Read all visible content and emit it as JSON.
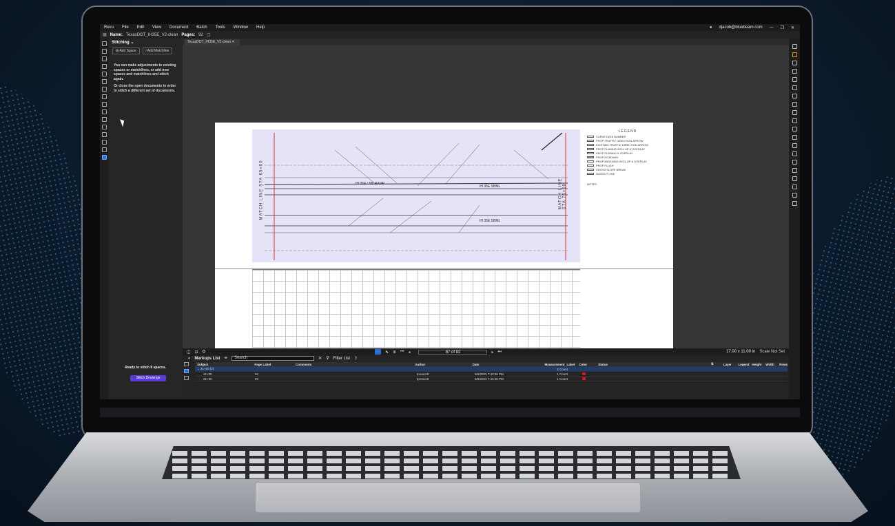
{
  "menu": [
    "Revu",
    "File",
    "Edit",
    "View",
    "Document",
    "Batch",
    "Tools",
    "Window",
    "Help"
  ],
  "account": "djacob@bluebeam.com",
  "tabbar": {
    "name_label": "Name:",
    "name_value": "TexasDOT_IH35E_V2-clean",
    "pages_label": "Pages:",
    "pages_value": "92"
  },
  "panel": {
    "title": "Stitching",
    "add_space": "Add Space",
    "add_matchline": "Add Matchline",
    "info1": "You can make adjustments to existing spaces or matchlines, or add new spaces and matchlines and stitch again.",
    "info2": "Or close the open documents in order to stitch a different set of documents.",
    "ready": "Ready to stitch 8 spaces.",
    "stitch_button": "Stitch Drawings"
  },
  "doc_tab": "TexasDOT_IH35E_V2-clean",
  "navbar": {
    "page": "87 of 92",
    "size": "17.00 x 11.00 in",
    "scale": "Scale Not Set"
  },
  "legend": {
    "title": "LEGEND",
    "items": [
      "CURVE DATA NUMBER",
      "PROP TRAFFIC DIRECTION ARROW",
      "EXISTING TRAFFIC DIRECTION ARROW",
      "PROP PLANING W/CL UP & OVERLAY",
      "PROP PLANING & OVERLAY",
      "PROP ROADWAY",
      "PROP WIDENING W/CL UP & OVERLAY",
      "PROP FLUSH",
      "CROSS SLOPE BREAK",
      "GUNOUT LINE"
    ],
    "notes": "NOTES:"
  },
  "plan_labels": [
    "IH 35E / NB RAMP",
    "IH 35E SBML",
    "IH 35E SBML",
    "MATCH LINE STA 65+00",
    "MATCH LINE STA 76+00"
  ],
  "markups": {
    "title": "Markups List",
    "search_placeholder": "Search",
    "filter": "Filter List",
    "columns": [
      "Subject",
      "Page Label",
      "Comments",
      "Author",
      "Date",
      "Measurement",
      "Label",
      "Color",
      "Status",
      "Layer",
      "Legend",
      "Height",
      "Width",
      "Rows"
    ],
    "rows": [
      {
        "subject": "21+00 (2)",
        "page": "",
        "comments": "",
        "author": "",
        "date": "",
        "measurement": "2 Count"
      },
      {
        "subject": "21+00",
        "page": "92",
        "comments": "",
        "author": "tprescott",
        "date": "5/6/2023 7:43:06 PM",
        "measurement": "1 Count"
      },
      {
        "subject": "21+00",
        "page": "93",
        "comments": "",
        "author": "tprescott",
        "date": "5/6/2023 7:43:48 PM",
        "measurement": "1 Count"
      }
    ]
  },
  "colors": {
    "accent": "#2a6fd6",
    "stitch_button": "#5b3bd6",
    "markup_chip": "#dd1122"
  }
}
